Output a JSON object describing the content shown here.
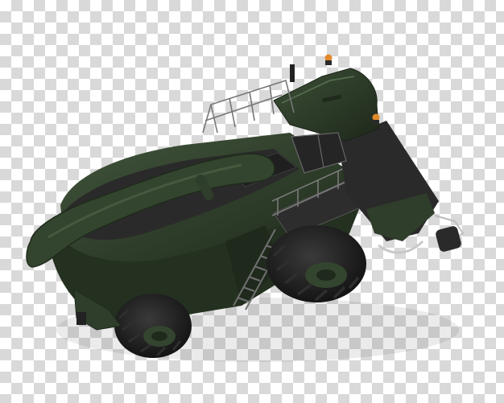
{
  "image": {
    "subject": "forage-harvester-machine-render",
    "background": "transparency-checkerboard"
  },
  "colors": {
    "body_green": "#2f3d2b",
    "body_green_light": "#42553c",
    "body_green_dark": "#1f2a1c",
    "deck_black": "#2a2a2a",
    "tire_black": "#1c1c1c",
    "tire_tread": "#2e2e2e",
    "hub_green": "#34452f",
    "warning_light": "#e08a2a",
    "rail_gray": "#6f6f6f",
    "chrome": "#c8c8c8",
    "checker_light": "#ffffff",
    "checker_dark": "#d9d9d9"
  }
}
